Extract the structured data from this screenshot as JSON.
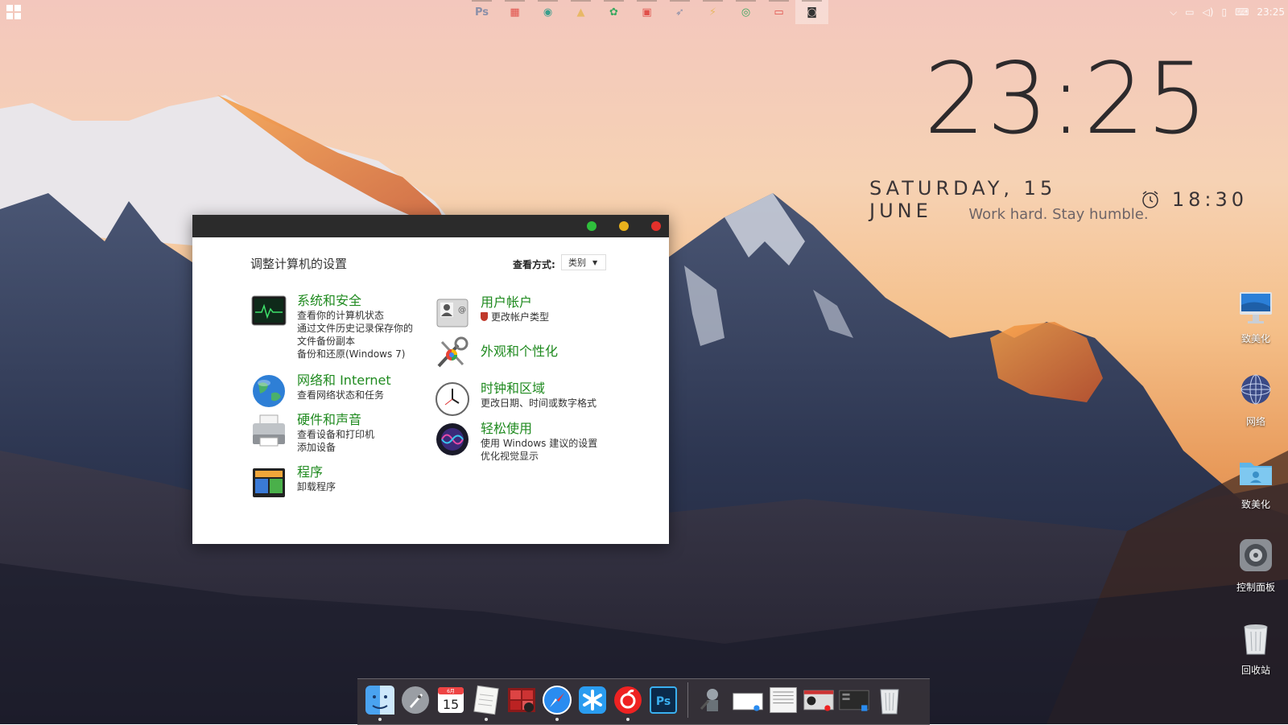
{
  "taskbar": {
    "pinned_apps": [
      {
        "name": "photoshop-icon",
        "glyph": "Ps",
        "color": "#8a8fa8"
      },
      {
        "name": "app-grid-icon",
        "glyph": "▦",
        "color": "#e0504a"
      },
      {
        "name": "camera-icon",
        "glyph": "◉",
        "color": "#3a9e8c"
      },
      {
        "name": "stamp-icon",
        "glyph": "▲",
        "color": "#e8b866"
      },
      {
        "name": "aperture-icon",
        "glyph": "✿",
        "color": "#3aa860"
      },
      {
        "name": "image-icon",
        "glyph": "▣",
        "color": "#e0504a"
      },
      {
        "name": "rocket-icon",
        "glyph": "➶",
        "color": "#8a8fa8"
      },
      {
        "name": "lightning-icon",
        "glyph": "⚡",
        "color": "#e8b866"
      },
      {
        "name": "chrome-icon",
        "glyph": "◎",
        "color": "#3aa860"
      },
      {
        "name": "monitor-icon",
        "glyph": "▭",
        "color": "#e0504a"
      },
      {
        "name": "screenshot-icon",
        "glyph": "◙",
        "color": "#333333"
      }
    ],
    "time": "23:25"
  },
  "clock_widget": {
    "time": "23:25",
    "date": "SATURDAY, 15 JUNE",
    "alarm": "18:30",
    "motto": "Work hard. Stay humble."
  },
  "desktop_icons": [
    {
      "label": "致美化",
      "icon": "imac-icon"
    },
    {
      "label": "网络",
      "icon": "network-globe-icon"
    },
    {
      "label": "致美化",
      "icon": "folder-icon"
    },
    {
      "label": "控制面板",
      "icon": "settings-gear-icon"
    },
    {
      "label": "回收站",
      "icon": "trash-icon"
    }
  ],
  "control_panel": {
    "heading": "调整计算机的设置",
    "view_label": "查看方式:",
    "view_value": "类别",
    "left_categories": [
      {
        "title": "系统和安全",
        "subs": [
          "查看你的计算机状态",
          "通过文件历史记录保存你的文件备份副本",
          "备份和还原(Windows 7)"
        ],
        "icon": "activity-monitor-icon"
      },
      {
        "title": "网络和 Internet",
        "subs": [
          "查看网络状态和任务"
        ],
        "icon": "globe-icon"
      },
      {
        "title": "硬件和声音",
        "subs": [
          "查看设备和打印机",
          "添加设备"
        ],
        "icon": "printer-icon"
      },
      {
        "title": "程序",
        "subs": [
          "卸载程序"
        ],
        "icon": "programs-icon"
      }
    ],
    "right_categories": [
      {
        "title": "用户帐户",
        "subs": [
          "更改帐户类型"
        ],
        "icon": "contacts-icon"
      },
      {
        "title": "外观和个性化",
        "subs": [],
        "icon": "color-tools-icon"
      },
      {
        "title": "时钟和区域",
        "subs": [
          "更改日期、时间或数字格式"
        ],
        "icon": "clock-icon"
      },
      {
        "title": "轻松使用",
        "subs": [
          "使用 Windows 建议的设置",
          "优化视觉显示"
        ],
        "icon": "siri-icon"
      }
    ]
  },
  "dock": {
    "calendar_month": "6月",
    "calendar_day": "15",
    "photoshop_glyph": "Ps"
  }
}
